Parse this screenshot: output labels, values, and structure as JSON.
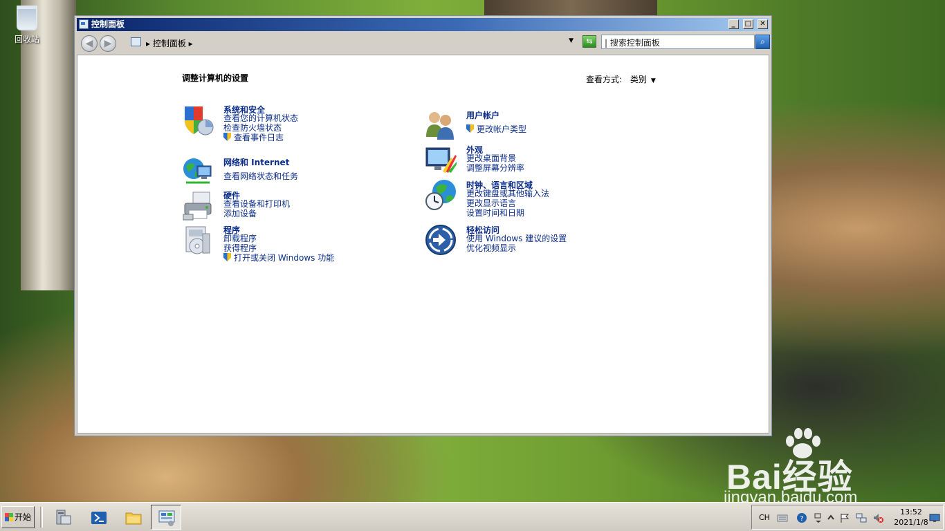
{
  "desktop": {
    "recycle_bin_label": "回收站"
  },
  "window": {
    "title": "控制面板",
    "controls": {
      "minimize": "_",
      "maximize": "□",
      "close": "✕"
    },
    "address_crumb": "控制面板",
    "search_placeholder": "搜索控制面板"
  },
  "content": {
    "heading": "调整计算机的设置",
    "view_by_label": "查看方式:",
    "view_by_value": "类别",
    "categories_left": [
      {
        "title": "系统和安全",
        "links": [
          "查看您的计算机状态",
          "检查防火墙状态",
          "查看事件日志"
        ]
      },
      {
        "title": "网络和 Internet",
        "links": [
          "查看网络状态和任务"
        ]
      },
      {
        "title": "硬件",
        "links": [
          "查看设备和打印机",
          "添加设备"
        ]
      },
      {
        "title": "程序",
        "links": [
          "卸载程序",
          "获得程序",
          "打开或关闭 Windows 功能"
        ]
      }
    ],
    "categories_right": [
      {
        "title": "用户帐户",
        "links": [
          "更改帐户类型"
        ]
      },
      {
        "title": "外观",
        "links": [
          "更改桌面背景",
          "调整屏幕分辨率"
        ]
      },
      {
        "title": "时钟、语言和区域",
        "links": [
          "更改键盘或其他输入法",
          "更改显示语言",
          "设置时间和日期"
        ]
      },
      {
        "title": "轻松访问",
        "links": [
          "使用 Windows 建议的设置",
          "优化视频显示"
        ]
      }
    ]
  },
  "taskbar": {
    "start_label": "开始",
    "lang": "CH",
    "time": "13:52",
    "date": "2021/1/8"
  },
  "watermark": {
    "brand": "Bai经验",
    "url": "jingyan.baidu.com"
  }
}
